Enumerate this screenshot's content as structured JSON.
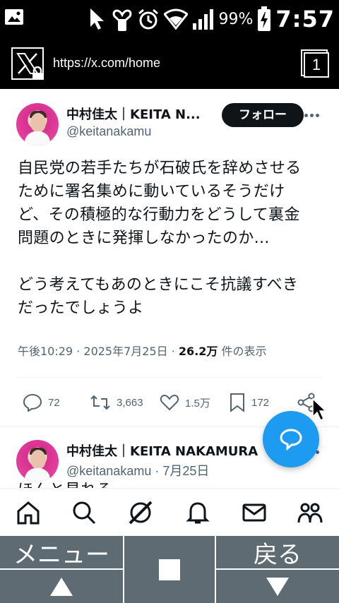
{
  "status_bar": {
    "battery_percent": "99%",
    "time": "7:57",
    "icons": [
      "image-icon",
      "cursor-icon",
      "heart-phone-icon",
      "alarm-icon",
      "wifi-icon",
      "signal-icon",
      "battery-charging-icon"
    ]
  },
  "browser": {
    "url": "https://x.com/home",
    "tab_count": "1",
    "site_icon": "x-logo-icon"
  },
  "tweets": [
    {
      "display_name": "中村佳太｜KEITA N...",
      "handle": "@keitanakamu",
      "follow_label": "フォロー",
      "text": "自民党の若手たちが石破氏を辞めさせる\nために署名集めに動いているそうだけ\nど、その積極的な行動力をどうして裏金\n問題のときに発揮しなかったのか…\n\nどう考えてもあのときにこそ抗議すべき\nだったでしょうよ",
      "time": "午後10:29",
      "date": "2025年7月25日",
      "views": "26.2万",
      "views_label": "件の表示",
      "replies": "72",
      "reposts": "3,663",
      "likes": "1.5万",
      "bookmarks": "172"
    },
    {
      "display_name": "中村佳太｜KEITA NAKAMURA",
      "handle": "@keitanakamu",
      "date": "7月25日",
      "text_preview": "ほんと見れる"
    }
  ],
  "nav": {
    "menu_label": "メニュー",
    "back_label": "戻る"
  },
  "colors": {
    "accent": "#1d9bf0",
    "nav_button": "#5e6b72",
    "text_primary": "#0f1419",
    "text_secondary": "#536471"
  }
}
